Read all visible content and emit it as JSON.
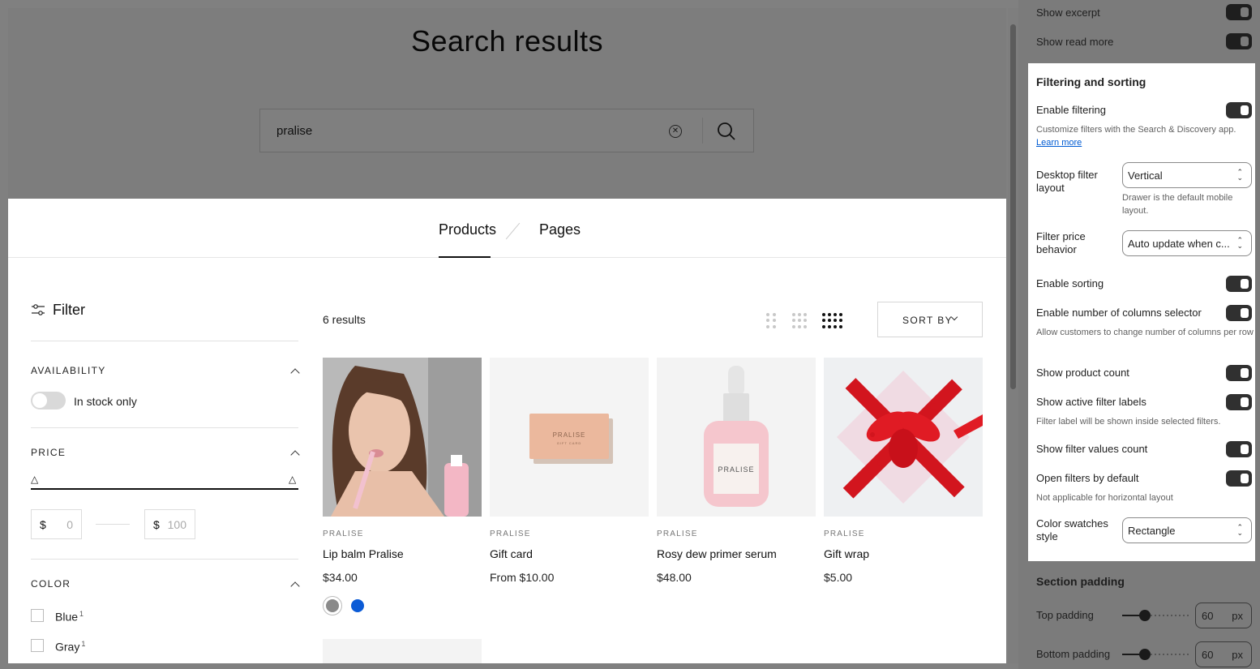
{
  "preview": {
    "page_title": "Search results",
    "search": {
      "value": "pralise",
      "clear_symbol": "✕"
    },
    "tabs": [
      {
        "label": "Products",
        "active": true
      },
      {
        "label": "Pages",
        "active": false
      }
    ],
    "filter": {
      "heading": "Filter",
      "availability": {
        "title": "AVAILABILITY",
        "toggle_label": "In stock only",
        "in_stock_only": false
      },
      "price": {
        "title": "PRICE",
        "currency": "$",
        "min_placeholder": "0",
        "max_placeholder": "100",
        "handle": "△"
      },
      "color": {
        "title": "COLOR",
        "options": [
          {
            "label": "Blue",
            "count": "1"
          },
          {
            "label": "Gray",
            "count": "1"
          }
        ]
      }
    },
    "results_count": "6 results",
    "grid_columns_selected": 4,
    "sort_label": "SORT BY",
    "products": [
      {
        "vendor": "PRALISE",
        "title": "Lip balm Pralise",
        "price": "$34.00",
        "image": "woman-applying-lip-gloss",
        "swatches": [
          "gray",
          "blue"
        ]
      },
      {
        "vendor": "PRALISE",
        "title": "Gift card",
        "price": "From $10.00",
        "image": "gift-card",
        "card_text": "PRALISE",
        "card_subtext": "GIFT CARD"
      },
      {
        "vendor": "PRALISE",
        "title": "Rosy dew primer serum",
        "price": "$48.00",
        "image": "pink-serum-bottle",
        "label_text": "PRALISE"
      },
      {
        "vendor": "PRALISE",
        "title": "Gift wrap",
        "price": "$5.00",
        "image": "gift-box-red-ribbon"
      }
    ]
  },
  "settings": {
    "dim_above": [
      {
        "label": "Show excerpt",
        "on": true
      },
      {
        "label": "Show read more",
        "on": true
      }
    ],
    "group": {
      "title": "Filtering and sorting",
      "enable_filtering": {
        "label": "Enable filtering",
        "on": true
      },
      "filtering_help": "Customize filters with the Search & Discovery app.",
      "learn_more": "Learn more",
      "desktop_layout": {
        "label": "Desktop filter layout",
        "value": "Vertical",
        "help": "Drawer is the default mobile layout."
      },
      "price_behavior": {
        "label": "Filter price behavior",
        "value": "Auto update when c..."
      },
      "enable_sorting": {
        "label": "Enable sorting",
        "on": true
      },
      "columns_selector": {
        "label": "Enable number of columns selector",
        "on": true,
        "help": "Allow customers to change number of columns per row"
      },
      "product_count": {
        "label": "Show product count",
        "on": true
      },
      "active_labels": {
        "label": "Show active filter labels",
        "on": true,
        "help": "Filter label will be shown inside selected filters."
      },
      "values_count": {
        "label": "Show filter values count",
        "on": true
      },
      "open_default": {
        "label": "Open filters by default",
        "on": true,
        "help": "Not applicable for horizontal layout"
      },
      "swatch_style": {
        "label": "Color swatches style",
        "value": "Rectangle"
      }
    },
    "section_padding": {
      "title": "Section padding",
      "top": {
        "label": "Top padding",
        "value": "60",
        "unit": "px"
      },
      "bottom": {
        "label": "Bottom padding",
        "value": "60",
        "unit": "px"
      }
    }
  },
  "colors": {
    "accent": "#111111",
    "link": "#005bd3",
    "toggle_on": "#303030",
    "swatch_blue": "#0b5bd6",
    "swatch_gray": "#8a8a8a"
  }
}
